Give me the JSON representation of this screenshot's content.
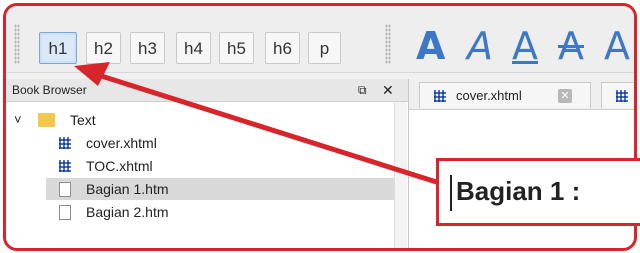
{
  "toolbar": {
    "heading_buttons": [
      {
        "label": "h1",
        "active": true
      },
      {
        "label": "h2",
        "active": false
      },
      {
        "label": "h3",
        "active": false
      },
      {
        "label": "h4",
        "active": false
      },
      {
        "label": "h5",
        "active": false
      },
      {
        "label": "h6",
        "active": false
      },
      {
        "label": "p",
        "active": false
      }
    ],
    "format_buttons": [
      "A",
      "A",
      "A",
      "A",
      "A"
    ]
  },
  "book_browser": {
    "title": "Book Browser",
    "float_icon": "⧉",
    "close_icon": "✕",
    "items": [
      {
        "label": "Text",
        "kind": "folder",
        "expanded": true,
        "expander": "˅"
      },
      {
        "label": "cover.xhtml",
        "kind": "xhtml"
      },
      {
        "label": "TOC.xhtml",
        "kind": "xhtml"
      },
      {
        "label": "Bagian 1.htm",
        "kind": "htm",
        "selected": true
      },
      {
        "label": "Bagian 2.htm",
        "kind": "htm"
      }
    ]
  },
  "editor": {
    "tabs": [
      {
        "label": "cover.xhtml",
        "close": "✕"
      }
    ]
  },
  "callout": {
    "text": "Bagian 1 :"
  },
  "colors": {
    "accent": "#d8252c",
    "icon_blue": "#3d77c8",
    "selected": "#d9d9d9"
  }
}
